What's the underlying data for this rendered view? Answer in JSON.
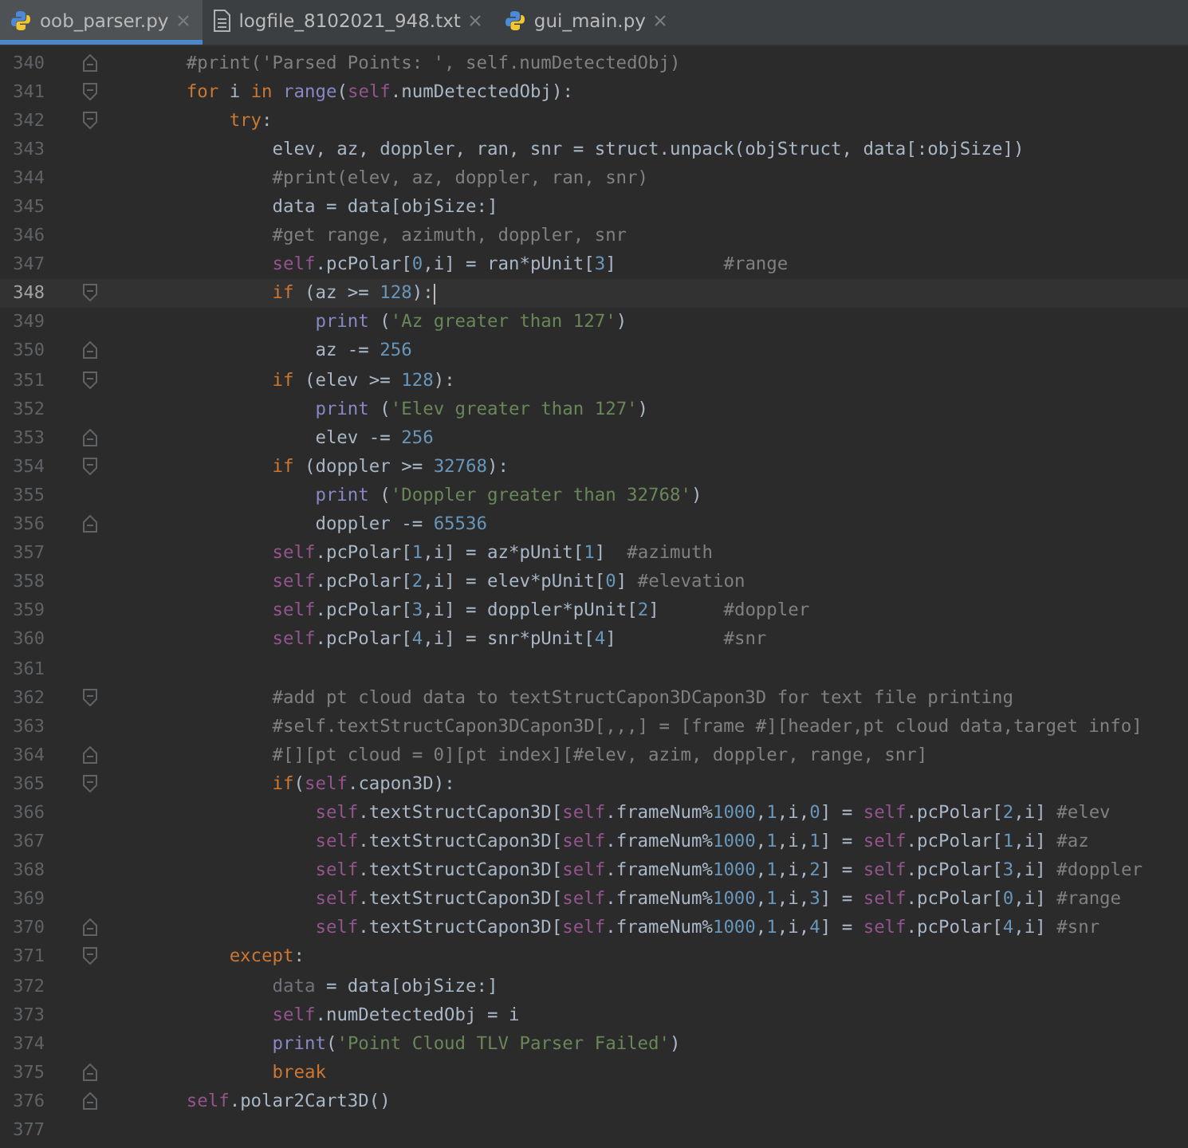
{
  "tabs": [
    {
      "label": "oob_parser.py",
      "kind": "python",
      "selected": true
    },
    {
      "label": "logfile_8102021_948.txt",
      "kind": "text",
      "selected": false
    },
    {
      "label": "gui_main.py",
      "kind": "python",
      "selected": false
    }
  ],
  "lines": [
    {
      "number": "340",
      "current": false,
      "kind": "closer",
      "tokens": [
        {
          "kind": "comment",
          "text": "        #print('Parsed Points: ', self.numDetectedObj)"
        }
      ]
    },
    {
      "number": "341",
      "current": false,
      "kind": "opener",
      "tokens": [
        {
          "kind": "keyword",
          "text": "        for"
        },
        {
          "kind": "plain",
          "text": " i "
        },
        {
          "kind": "keyword",
          "text": "in"
        },
        {
          "kind": "builtin",
          "text": " range"
        },
        {
          "kind": "plain",
          "text": "("
        },
        {
          "kind": "self",
          "text": "self"
        },
        {
          "kind": "plain",
          "text": ".numDetectedObj):"
        }
      ]
    },
    {
      "number": "342",
      "current": false,
      "kind": "opener",
      "tokens": [
        {
          "kind": "keyword",
          "text": "            try"
        },
        {
          "kind": "plain",
          "text": ":"
        }
      ]
    },
    {
      "number": "343",
      "current": false,
      "kind": "code",
      "tokens": [
        {
          "kind": "plain",
          "text": "                elev, az, doppler, ran, snr = struct.unpack(objStruct, data[:objSize])"
        }
      ]
    },
    {
      "number": "344",
      "current": false,
      "kind": "code",
      "tokens": [
        {
          "kind": "comment",
          "text": "                #print(elev, az, doppler, ran, snr)"
        }
      ]
    },
    {
      "number": "345",
      "current": false,
      "kind": "code",
      "tokens": [
        {
          "kind": "plain",
          "text": "                data = data[objSize:]"
        }
      ]
    },
    {
      "number": "346",
      "current": false,
      "kind": "code",
      "tokens": [
        {
          "kind": "comment",
          "text": "                #get range, azimuth, doppler, snr"
        }
      ]
    },
    {
      "number": "347",
      "current": false,
      "kind": "code",
      "tokens": [
        {
          "kind": "self",
          "text": "                self"
        },
        {
          "kind": "plain",
          "text": ".pcPolar["
        },
        {
          "kind": "number",
          "text": "0"
        },
        {
          "kind": "plain",
          "text": ",i] = ran*pUnit["
        },
        {
          "kind": "number",
          "text": "3"
        },
        {
          "kind": "plain",
          "text": "]"
        },
        {
          "kind": "comment",
          "text": "          #range"
        }
      ]
    },
    {
      "number": "348",
      "current": true,
      "kind": "opener",
      "tokens": [
        {
          "kind": "keyword",
          "text": "                if"
        },
        {
          "kind": "plain",
          "text": " (az >= "
        },
        {
          "kind": "number",
          "text": "128"
        },
        {
          "kind": "plain",
          "text": "):"
        }
      ]
    },
    {
      "number": "349",
      "current": false,
      "kind": "code",
      "tokens": [
        {
          "kind": "builtin",
          "text": "                    print"
        },
        {
          "kind": "plain",
          "text": " ("
        },
        {
          "kind": "string",
          "text": "'Az greater than 127'"
        },
        {
          "kind": "plain",
          "text": ")"
        }
      ]
    },
    {
      "number": "350",
      "current": false,
      "kind": "closer",
      "tokens": [
        {
          "kind": "plain",
          "text": "                    az -= "
        },
        {
          "kind": "number",
          "text": "256"
        }
      ]
    },
    {
      "number": "351",
      "current": false,
      "kind": "opener",
      "tokens": [
        {
          "kind": "keyword",
          "text": "                if"
        },
        {
          "kind": "plain",
          "text": " (elev >= "
        },
        {
          "kind": "number",
          "text": "128"
        },
        {
          "kind": "plain",
          "text": "):"
        }
      ]
    },
    {
      "number": "352",
      "current": false,
      "kind": "code",
      "tokens": [
        {
          "kind": "builtin",
          "text": "                    print"
        },
        {
          "kind": "plain",
          "text": " ("
        },
        {
          "kind": "string",
          "text": "'Elev greater than 127'"
        },
        {
          "kind": "plain",
          "text": ")"
        }
      ]
    },
    {
      "number": "353",
      "current": false,
      "kind": "closer",
      "tokens": [
        {
          "kind": "plain",
          "text": "                    elev -= "
        },
        {
          "kind": "number",
          "text": "256"
        }
      ]
    },
    {
      "number": "354",
      "current": false,
      "kind": "opener",
      "tokens": [
        {
          "kind": "keyword",
          "text": "                if"
        },
        {
          "kind": "plain",
          "text": " (doppler >= "
        },
        {
          "kind": "number",
          "text": "32768"
        },
        {
          "kind": "plain",
          "text": "):"
        }
      ]
    },
    {
      "number": "355",
      "current": false,
      "kind": "code",
      "tokens": [
        {
          "kind": "builtin",
          "text": "                    print"
        },
        {
          "kind": "plain",
          "text": " ("
        },
        {
          "kind": "string",
          "text": "'Doppler greater than 32768'"
        },
        {
          "kind": "plain",
          "text": ")"
        }
      ]
    },
    {
      "number": "356",
      "current": false,
      "kind": "closer",
      "tokens": [
        {
          "kind": "plain",
          "text": "                    doppler -= "
        },
        {
          "kind": "number",
          "text": "65536"
        }
      ]
    },
    {
      "number": "357",
      "current": false,
      "kind": "code",
      "tokens": [
        {
          "kind": "self",
          "text": "                self"
        },
        {
          "kind": "plain",
          "text": ".pcPolar["
        },
        {
          "kind": "number",
          "text": "1"
        },
        {
          "kind": "plain",
          "text": ",i] = az*pUnit["
        },
        {
          "kind": "number",
          "text": "1"
        },
        {
          "kind": "plain",
          "text": "]"
        },
        {
          "kind": "comment",
          "text": "  #azimuth"
        }
      ]
    },
    {
      "number": "358",
      "current": false,
      "kind": "code",
      "tokens": [
        {
          "kind": "self",
          "text": "                self"
        },
        {
          "kind": "plain",
          "text": ".pcPolar["
        },
        {
          "kind": "number",
          "text": "2"
        },
        {
          "kind": "plain",
          "text": ",i] = elev*pUnit["
        },
        {
          "kind": "number",
          "text": "0"
        },
        {
          "kind": "plain",
          "text": "]"
        },
        {
          "kind": "comment",
          "text": " #elevation"
        }
      ]
    },
    {
      "number": "359",
      "current": false,
      "kind": "code",
      "tokens": [
        {
          "kind": "self",
          "text": "                self"
        },
        {
          "kind": "plain",
          "text": ".pcPolar["
        },
        {
          "kind": "number",
          "text": "3"
        },
        {
          "kind": "plain",
          "text": ",i] = doppler*pUnit["
        },
        {
          "kind": "number",
          "text": "2"
        },
        {
          "kind": "plain",
          "text": "]"
        },
        {
          "kind": "comment",
          "text": "      #doppler"
        }
      ]
    },
    {
      "number": "360",
      "current": false,
      "kind": "code",
      "tokens": [
        {
          "kind": "self",
          "text": "                self"
        },
        {
          "kind": "plain",
          "text": ".pcPolar["
        },
        {
          "kind": "number",
          "text": "4"
        },
        {
          "kind": "plain",
          "text": ",i] = snr*pUnit["
        },
        {
          "kind": "number",
          "text": "4"
        },
        {
          "kind": "plain",
          "text": "]"
        },
        {
          "kind": "comment",
          "text": "          #snr"
        }
      ]
    },
    {
      "number": "361",
      "current": false,
      "kind": "code"
    },
    {
      "number": "362",
      "current": false,
      "kind": "opener",
      "tokens": [
        {
          "kind": "comment",
          "text": "                #add pt cloud data to textStructCapon3DCapon3D for text file printing"
        }
      ]
    },
    {
      "number": "363",
      "current": false,
      "kind": "code",
      "tokens": [
        {
          "kind": "comment",
          "text": "                #self.textStructCapon3DCapon3D[,,,] = [frame #][header,pt cloud data,target info]"
        }
      ]
    },
    {
      "number": "364",
      "current": false,
      "kind": "closer",
      "tokens": [
        {
          "kind": "comment",
          "text": "                #[][pt cloud = 0][pt index][#elev, azim, doppler, range, snr]"
        }
      ]
    },
    {
      "number": "365",
      "current": false,
      "kind": "opener",
      "tokens": [
        {
          "kind": "keyword",
          "text": "                if"
        },
        {
          "kind": "plain",
          "text": "("
        },
        {
          "kind": "self",
          "text": "self"
        },
        {
          "kind": "plain",
          "text": ".capon3D):"
        }
      ]
    },
    {
      "number": "366",
      "current": false,
      "kind": "code",
      "tokens": [
        {
          "kind": "self",
          "text": "                    self"
        },
        {
          "kind": "plain",
          "text": ".textStructCapon3D["
        },
        {
          "kind": "self",
          "text": "self"
        },
        {
          "kind": "plain",
          "text": ".frameNum%"
        },
        {
          "kind": "number",
          "text": "1000"
        },
        {
          "kind": "plain",
          "text": ","
        },
        {
          "kind": "number",
          "text": "1"
        },
        {
          "kind": "plain",
          "text": ",i,"
        },
        {
          "kind": "number",
          "text": "0"
        },
        {
          "kind": "plain",
          "text": "] = "
        },
        {
          "kind": "self",
          "text": "self"
        },
        {
          "kind": "plain",
          "text": ".pcPolar["
        },
        {
          "kind": "number",
          "text": "2"
        },
        {
          "kind": "plain",
          "text": ",i]"
        },
        {
          "kind": "comment",
          "text": " #elev"
        }
      ]
    },
    {
      "number": "367",
      "current": false,
      "kind": "code",
      "tokens": [
        {
          "kind": "self",
          "text": "                    self"
        },
        {
          "kind": "plain",
          "text": ".textStructCapon3D["
        },
        {
          "kind": "self",
          "text": "self"
        },
        {
          "kind": "plain",
          "text": ".frameNum%"
        },
        {
          "kind": "number",
          "text": "1000"
        },
        {
          "kind": "plain",
          "text": ","
        },
        {
          "kind": "number",
          "text": "1"
        },
        {
          "kind": "plain",
          "text": ",i,"
        },
        {
          "kind": "number",
          "text": "1"
        },
        {
          "kind": "plain",
          "text": "] = "
        },
        {
          "kind": "self",
          "text": "self"
        },
        {
          "kind": "plain",
          "text": ".pcPolar["
        },
        {
          "kind": "number",
          "text": "1"
        },
        {
          "kind": "plain",
          "text": ",i]"
        },
        {
          "kind": "comment",
          "text": " #az"
        }
      ]
    },
    {
      "number": "368",
      "current": false,
      "kind": "code",
      "tokens": [
        {
          "kind": "self",
          "text": "                    self"
        },
        {
          "kind": "plain",
          "text": ".textStructCapon3D["
        },
        {
          "kind": "self",
          "text": "self"
        },
        {
          "kind": "plain",
          "text": ".frameNum%"
        },
        {
          "kind": "number",
          "text": "1000"
        },
        {
          "kind": "plain",
          "text": ","
        },
        {
          "kind": "number",
          "text": "1"
        },
        {
          "kind": "plain",
          "text": ",i,"
        },
        {
          "kind": "number",
          "text": "2"
        },
        {
          "kind": "plain",
          "text": "] = "
        },
        {
          "kind": "self",
          "text": "self"
        },
        {
          "kind": "plain",
          "text": ".pcPolar["
        },
        {
          "kind": "number",
          "text": "3"
        },
        {
          "kind": "plain",
          "text": ",i]"
        },
        {
          "kind": "comment",
          "text": " #doppler"
        }
      ]
    },
    {
      "number": "369",
      "current": false,
      "kind": "code",
      "tokens": [
        {
          "kind": "self",
          "text": "                    self"
        },
        {
          "kind": "plain",
          "text": ".textStructCapon3D["
        },
        {
          "kind": "self",
          "text": "self"
        },
        {
          "kind": "plain",
          "text": ".frameNum%"
        },
        {
          "kind": "number",
          "text": "1000"
        },
        {
          "kind": "plain",
          "text": ","
        },
        {
          "kind": "number",
          "text": "1"
        },
        {
          "kind": "plain",
          "text": ",i,"
        },
        {
          "kind": "number",
          "text": "3"
        },
        {
          "kind": "plain",
          "text": "] = "
        },
        {
          "kind": "self",
          "text": "self"
        },
        {
          "kind": "plain",
          "text": ".pcPolar["
        },
        {
          "kind": "number",
          "text": "0"
        },
        {
          "kind": "plain",
          "text": ",i]"
        },
        {
          "kind": "comment",
          "text": " #range"
        }
      ]
    },
    {
      "number": "370",
      "current": false,
      "kind": "closer",
      "tokens": [
        {
          "kind": "self",
          "text": "                    self"
        },
        {
          "kind": "plain",
          "text": ".textStructCapon3D["
        },
        {
          "kind": "self",
          "text": "self"
        },
        {
          "kind": "plain",
          "text": ".frameNum%"
        },
        {
          "kind": "number",
          "text": "1000"
        },
        {
          "kind": "plain",
          "text": ","
        },
        {
          "kind": "number",
          "text": "1"
        },
        {
          "kind": "plain",
          "text": ",i,"
        },
        {
          "kind": "number",
          "text": "4"
        },
        {
          "kind": "plain",
          "text": "] = "
        },
        {
          "kind": "self",
          "text": "self"
        },
        {
          "kind": "plain",
          "text": ".pcPolar["
        },
        {
          "kind": "number",
          "text": "4"
        },
        {
          "kind": "plain",
          "text": ",i]"
        },
        {
          "kind": "comment",
          "text": " #snr"
        }
      ]
    },
    {
      "number": "371",
      "current": false,
      "kind": "opener",
      "tokens": [
        {
          "kind": "keyword",
          "text": "            except"
        },
        {
          "kind": "plain",
          "text": ":"
        }
      ]
    },
    {
      "number": "372",
      "current": false,
      "kind": "code",
      "tokens": [
        {
          "kind": "unused",
          "text": "                data"
        },
        {
          "kind": "plain",
          "text": " = data[objSize:]"
        }
      ]
    },
    {
      "number": "373",
      "current": false,
      "kind": "code",
      "tokens": [
        {
          "kind": "self",
          "text": "                self"
        },
        {
          "kind": "plain",
          "text": ".numDetectedObj = i"
        }
      ]
    },
    {
      "number": "374",
      "current": false,
      "kind": "code",
      "tokens": [
        {
          "kind": "builtin",
          "text": "                print"
        },
        {
          "kind": "plain",
          "text": "("
        },
        {
          "kind": "string",
          "text": "'Point Cloud TLV Parser Failed'"
        },
        {
          "kind": "plain",
          "text": ")"
        }
      ]
    },
    {
      "number": "375",
      "current": false,
      "kind": "closer",
      "tokens": [
        {
          "kind": "keyword",
          "text": "                break"
        }
      ]
    },
    {
      "number": "376",
      "current": false,
      "kind": "closer",
      "tokens": [
        {
          "kind": "self",
          "text": "        self"
        },
        {
          "kind": "plain",
          "text": ".polar2Cart3D()"
        }
      ]
    },
    {
      "number": "377",
      "current": false,
      "kind": "code"
    }
  ]
}
